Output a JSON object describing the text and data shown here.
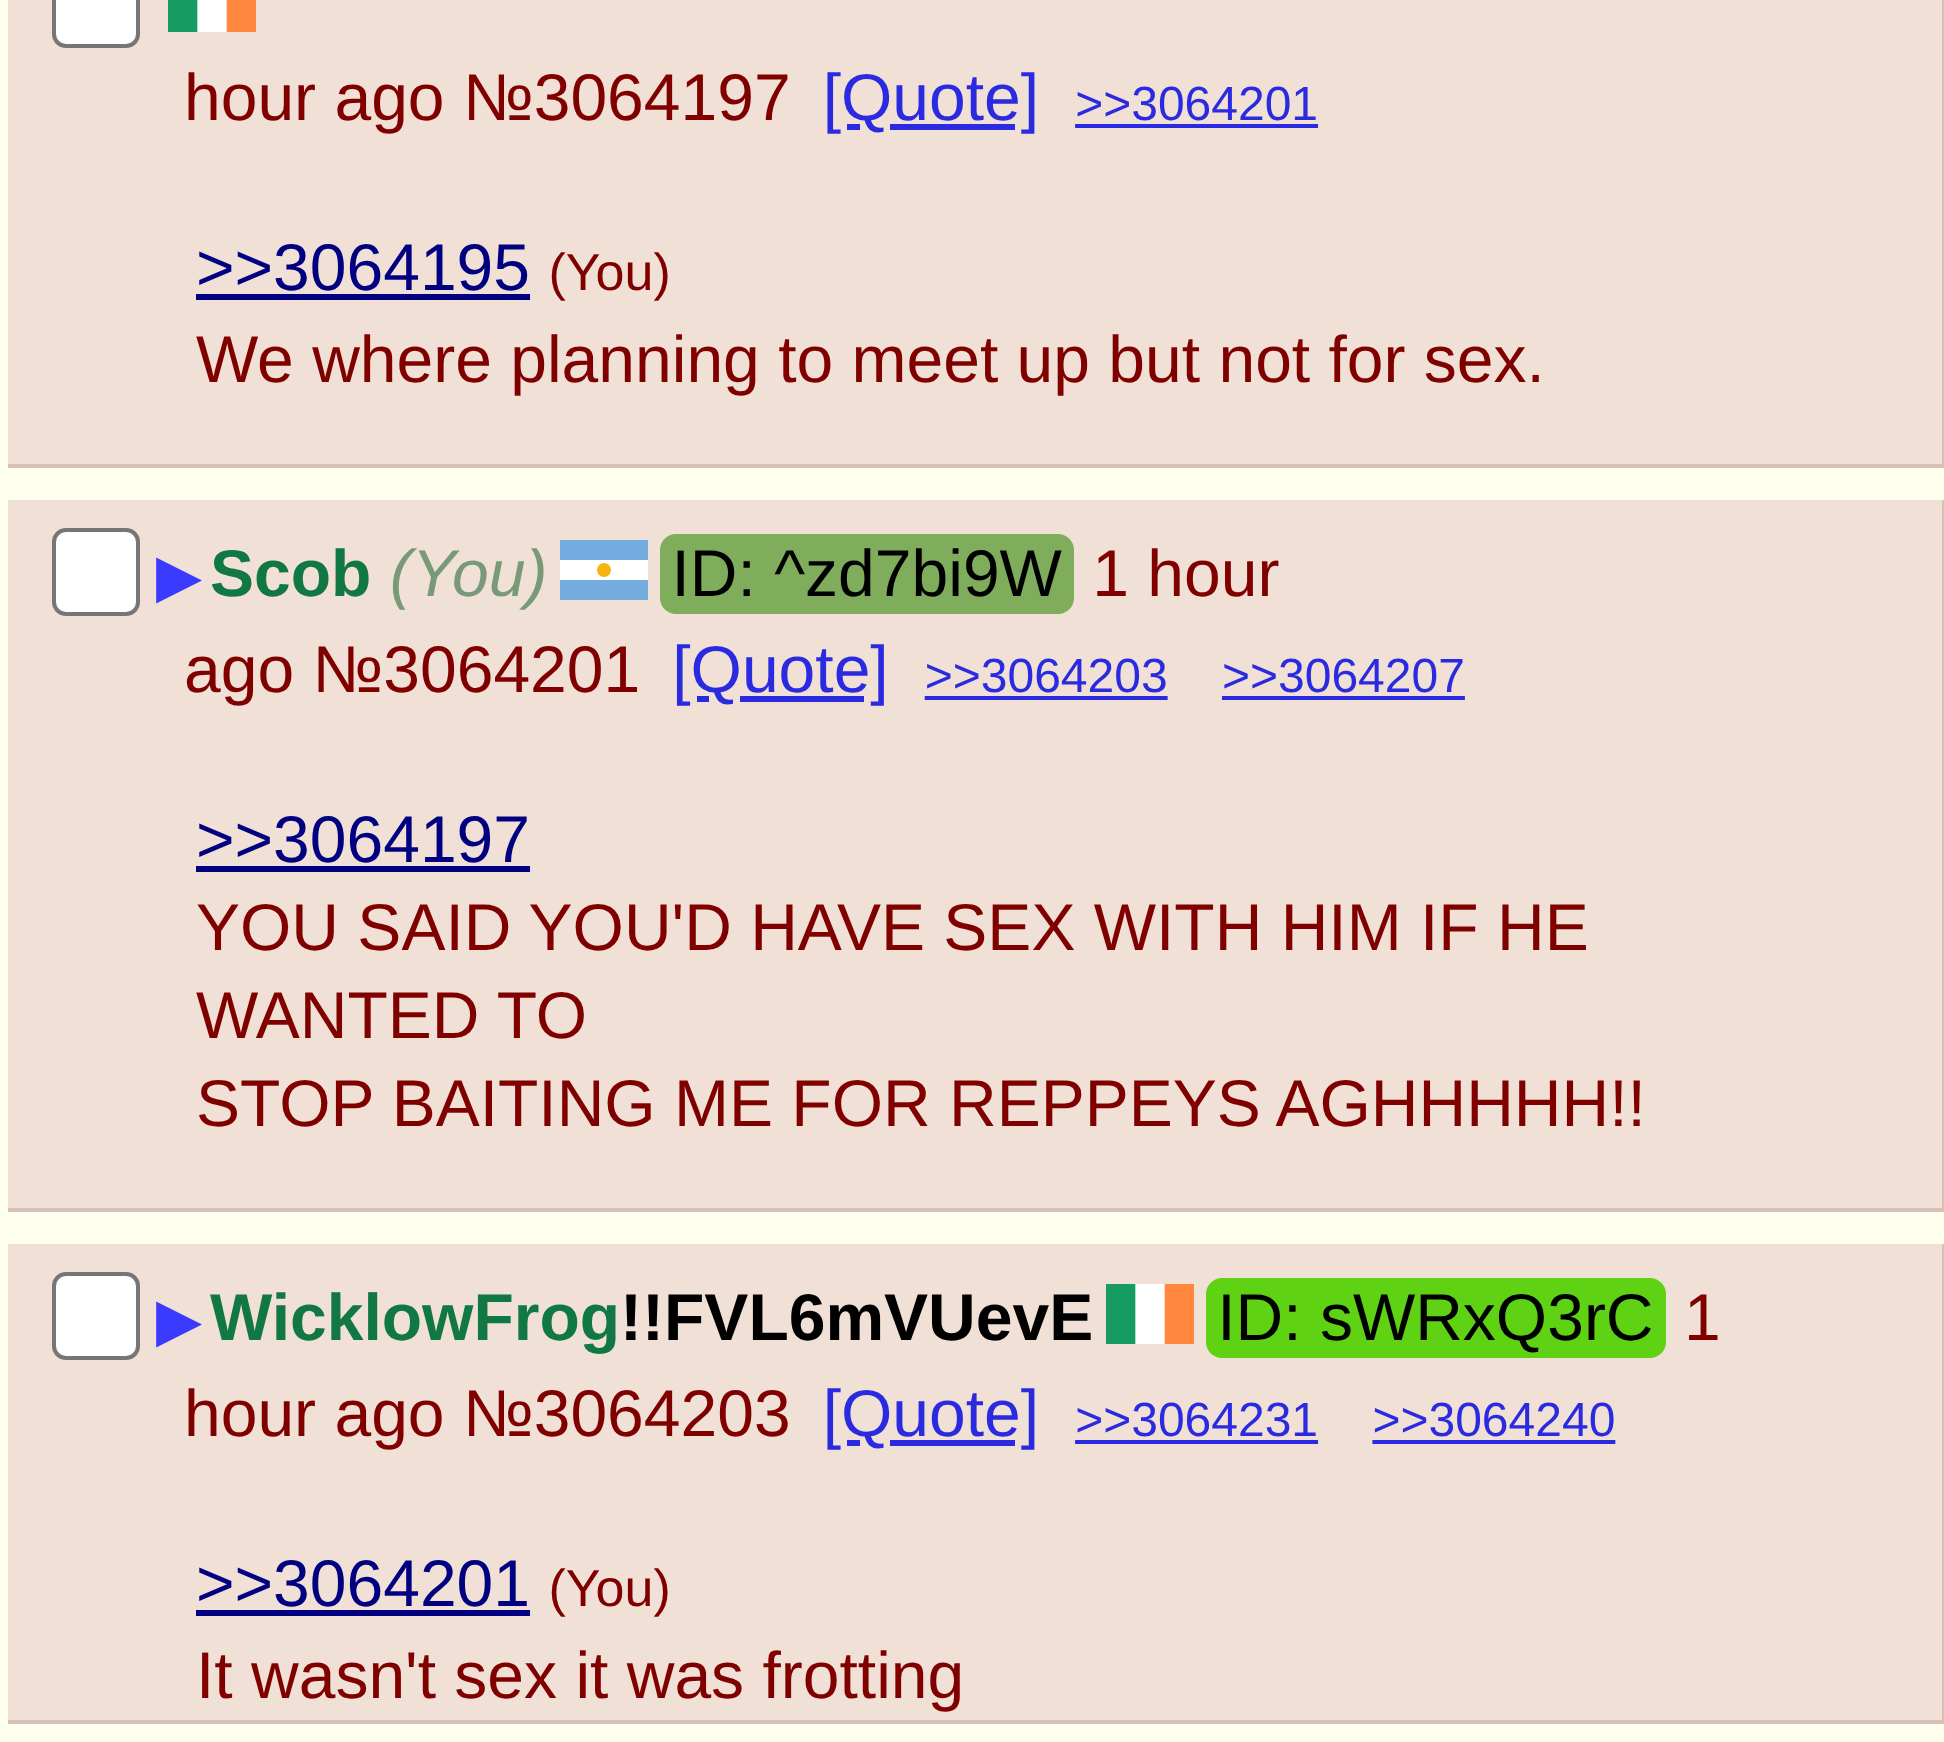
{
  "posts": [
    {
      "checked": false,
      "flag": {
        "kind": "ireland"
      },
      "date_lines": [
        "hour ago"
      ],
      "number": "№3064197",
      "quote": "[Quote]",
      "backlinks": [
        ">>3064201"
      ],
      "body": [
        {
          "kind": "quotelink",
          "text": ">>3064195",
          "you": "(You)"
        },
        {
          "kind": "text",
          "text": "We where planning to meet up but not for sex."
        }
      ]
    },
    {
      "checked": false,
      "arrow": "▶",
      "name": "Scob",
      "you": "(You)",
      "flag": {
        "kind": "argentina"
      },
      "id": {
        "text": "ID: ^zd7bi9W",
        "color": "#7fad5c"
      },
      "date_lines": [
        "1 hour",
        "ago"
      ],
      "number": "№3064201",
      "quote": "[Quote]",
      "backlinks": [
        ">>3064203",
        ">>3064207"
      ],
      "body": [
        {
          "kind": "quotelink",
          "text": ">>3064197"
        },
        {
          "kind": "text",
          "text": "YOU SAID YOU'D HAVE SEX WITH HIM IF HE WANTED TO"
        },
        {
          "kind": "text",
          "text": "STOP BAITING ME FOR REPPEYS AGHHHHH!!"
        }
      ]
    },
    {
      "checked": false,
      "arrow": "▶",
      "name": "WicklowFrog",
      "tripcode": "!!FVL6mVUevE",
      "flag": {
        "kind": "ireland"
      },
      "id": {
        "text": "ID: sWRxQ3rC",
        "color": "#5fd214"
      },
      "date_lines": [
        "1",
        "hour ago"
      ],
      "number": "№3064203",
      "quote": "[Quote]",
      "backlinks": [
        ">>3064231",
        ">>3064240"
      ],
      "body": [
        {
          "kind": "quotelink",
          "text": ">>3064201",
          "you": "(You)"
        },
        {
          "kind": "text",
          "text": "It wasn't sex it was frotting"
        }
      ]
    }
  ]
}
